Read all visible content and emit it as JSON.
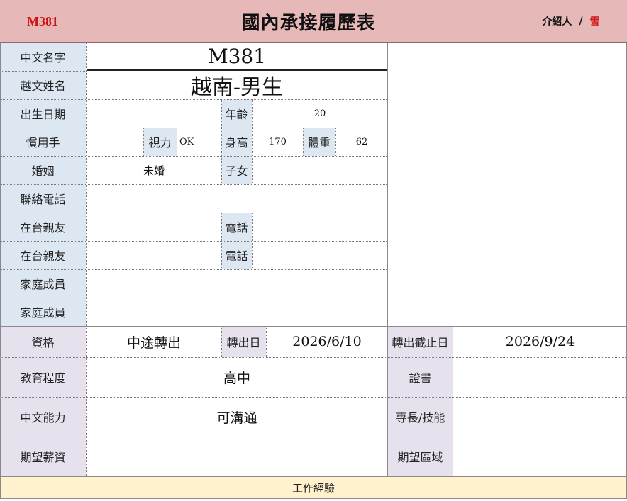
{
  "header": {
    "code": "M381",
    "title": "國內承接履歷表",
    "introducer_label": "介紹人",
    "introducer_sep": "/",
    "introducer_name": "雪"
  },
  "profile": {
    "chinese_name_label": "中文名字",
    "chinese_name": "M381",
    "viet_name_label": "越文姓名",
    "viet_name": "越南-男生",
    "birth_label": "出生日期",
    "birth_value": "",
    "age_label": "年齡",
    "age": "20",
    "hand_label": "慣用手",
    "hand_value": "",
    "vision_label": "視力",
    "vision": "OK",
    "height_label": "身高",
    "height": "170",
    "weight_label": "體重",
    "weight": "62",
    "marriage_label": "婚姻",
    "marriage": "未婚",
    "children_label": "子女",
    "children": "",
    "phone_label": "聯絡電話",
    "phone": "",
    "relative1_label": "在台親友",
    "relative1_phone_label": "電話",
    "relative2_label": "在台親友",
    "relative2_phone_label": "電話",
    "family1_label": "家庭成員",
    "family2_label": "家庭成員"
  },
  "qualification": {
    "label": "資格",
    "value": "中途轉出",
    "transfer_date_label": "轉出日",
    "transfer_date": "2026/6/10",
    "deadline_label": "轉出截止日",
    "deadline": "2026/9/24"
  },
  "education": {
    "label": "教育程度",
    "value": "高中",
    "cert_label": "證書",
    "cert_value": ""
  },
  "language": {
    "label": "中文能力",
    "value": "可溝通",
    "skill_label": "專長/技能",
    "skill_value": ""
  },
  "expectation": {
    "salary_label": "期望薪資",
    "salary_value": "",
    "region_label": "期望區域",
    "region_value": ""
  },
  "work": {
    "label": "工作經驗"
  }
}
